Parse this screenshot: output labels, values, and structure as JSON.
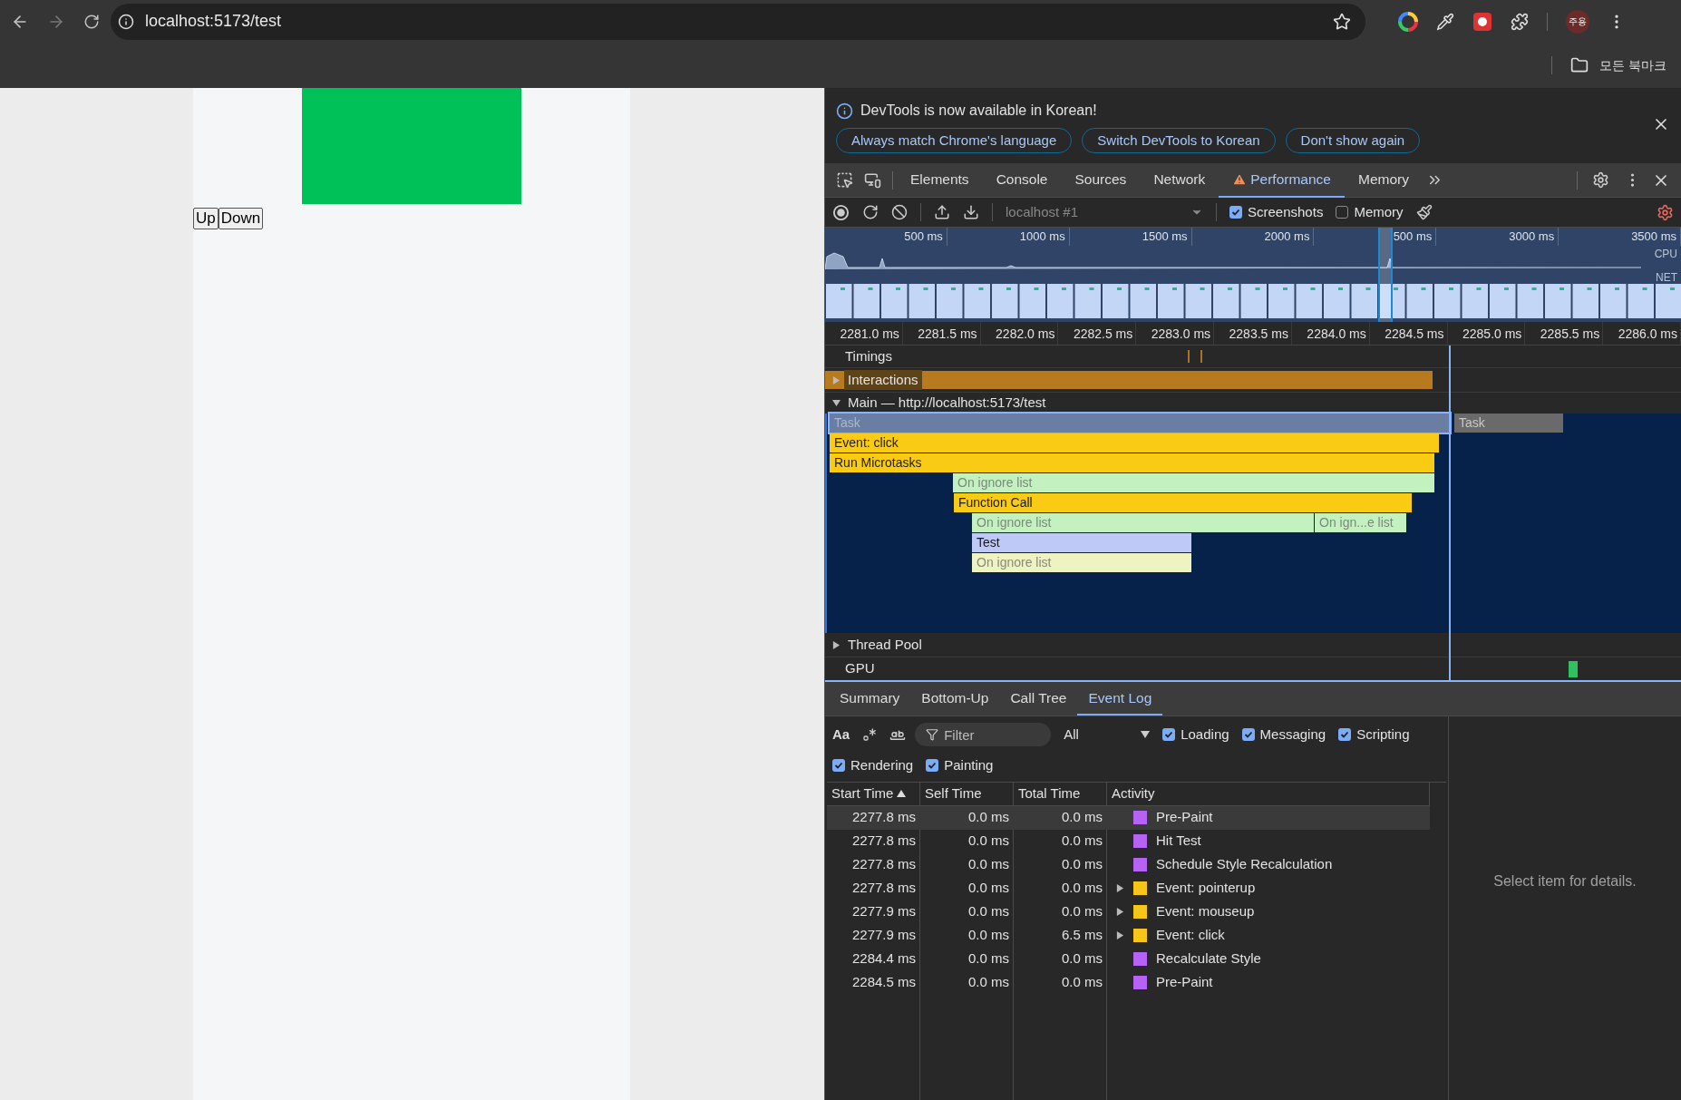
{
  "browser": {
    "url": "localhost:5173/test",
    "profile": "주용",
    "bookmarks": "모든 북마크"
  },
  "page": {
    "buttons": [
      "Up",
      "Down"
    ]
  },
  "devtools": {
    "notice": {
      "message": "DevTools is now available in Korean!",
      "buttons": [
        "Always match Chrome's language",
        "Switch DevTools to Korean",
        "Don't show again"
      ]
    },
    "tabs": [
      {
        "label": "Elements",
        "selected": false,
        "warning": false
      },
      {
        "label": "Console",
        "selected": false,
        "warning": false
      },
      {
        "label": "Sources",
        "selected": false,
        "warning": false
      },
      {
        "label": "Network",
        "selected": false,
        "warning": false
      },
      {
        "label": "Performance",
        "selected": true,
        "warning": true
      },
      {
        "label": "Memory",
        "selected": false,
        "warning": false
      }
    ],
    "toolbar": {
      "target": "localhost #1",
      "options": [
        {
          "label": "Screenshots",
          "checked": true
        },
        {
          "label": "Memory",
          "checked": false
        }
      ]
    },
    "overview": {
      "ticks": [
        "500 ms",
        "1000 ms",
        "1500 ms",
        "2000 ms",
        "500 ms",
        "3000 ms",
        "3500 ms"
      ],
      "lanes": [
        "CPU",
        "NET"
      ]
    },
    "ruler": [
      "2281.0 ms",
      "2281.5 ms",
      "2282.0 ms",
      "2282.5 ms",
      "2283.0 ms",
      "2283.5 ms",
      "2284.0 ms",
      "2284.5 ms",
      "2285.0 ms",
      "2285.5 ms",
      "2286.0 ms"
    ],
    "tracks": {
      "timings": "Timings",
      "interactions": {
        "label": "Interactions",
        "expanded": false
      },
      "main": {
        "label": "Main — http://localhost:5173/test",
        "expanded": true
      },
      "thread_pool": {
        "label": "Thread Pool",
        "expanded": false
      },
      "gpu": "GPU"
    },
    "flame": [
      {
        "kind": "task",
        "label": "Task",
        "selected": true
      },
      {
        "kind": "task",
        "label": "Task",
        "selected": false
      },
      {
        "kind": "event",
        "label": "Event: click",
        "selected": false
      },
      {
        "kind": "event",
        "label": "Run Microtasks",
        "selected": false
      },
      {
        "kind": "ignored",
        "label": "On ignore list",
        "selected": false
      },
      {
        "kind": "event",
        "label": "Function Call",
        "selected": false
      },
      {
        "kind": "ignored",
        "label": "On ignore list",
        "selected": false
      },
      {
        "kind": "ignored",
        "label": "On ign...e list",
        "selected": false
      },
      {
        "kind": "script",
        "label": "Test",
        "selected": false
      },
      {
        "kind": "ignored-light",
        "label": "On ignore list",
        "selected": false
      }
    ],
    "bottom_tabs": [
      {
        "label": "Summary",
        "selected": false
      },
      {
        "label": "Bottom-Up",
        "selected": false
      },
      {
        "label": "Call Tree",
        "selected": false
      },
      {
        "label": "Event Log",
        "selected": true
      }
    ],
    "filter": {
      "case_label": "Aa",
      "placeholder": "Filter",
      "level": "All",
      "categories": [
        {
          "label": "Loading",
          "checked": true
        },
        {
          "label": "Messaging",
          "checked": true
        },
        {
          "label": "Scripting",
          "checked": true
        },
        {
          "label": "Rendering",
          "checked": true
        },
        {
          "label": "Painting",
          "checked": true
        }
      ]
    },
    "table": {
      "columns": [
        {
          "label": "Start Time",
          "sorted": true
        },
        {
          "label": "Self Time",
          "sorted": false
        },
        {
          "label": "Total Time",
          "sorted": false
        },
        {
          "label": "Activity",
          "sorted": false
        }
      ],
      "rows": [
        {
          "start": "2277.8 ms",
          "self": "0.0 ms",
          "total": "0.0 ms",
          "activity": "Pre-Paint",
          "color": "#b562f5",
          "expandable": false,
          "selected": true
        },
        {
          "start": "2277.8 ms",
          "self": "0.0 ms",
          "total": "0.0 ms",
          "activity": "Hit Test",
          "color": "#b562f5",
          "expandable": false,
          "selected": false
        },
        {
          "start": "2277.8 ms",
          "self": "0.0 ms",
          "total": "0.0 ms",
          "activity": "Schedule Style Recalculation",
          "color": "#b562f5",
          "expandable": false,
          "selected": false
        },
        {
          "start": "2277.8 ms",
          "self": "0.0 ms",
          "total": "0.0 ms",
          "activity": "Event: pointerup",
          "color": "#f5c518",
          "expandable": true,
          "selected": false
        },
        {
          "start": "2277.9 ms",
          "self": "0.0 ms",
          "total": "0.0 ms",
          "activity": "Event: mouseup",
          "color": "#f5c518",
          "expandable": true,
          "selected": false
        },
        {
          "start": "2277.9 ms",
          "self": "0.0 ms",
          "total": "6.5 ms",
          "activity": "Event: click",
          "color": "#f5c518",
          "expandable": true,
          "selected": false
        },
        {
          "start": "2284.4 ms",
          "self": "0.0 ms",
          "total": "0.0 ms",
          "activity": "Recalculate Style",
          "color": "#b562f5",
          "expandable": false,
          "selected": false
        },
        {
          "start": "2284.5 ms",
          "self": "0.0 ms",
          "total": "0.0 ms",
          "activity": "Pre-Paint",
          "color": "#b562f5",
          "expandable": false,
          "selected": false
        }
      ]
    },
    "details": "Select item for details."
  }
}
